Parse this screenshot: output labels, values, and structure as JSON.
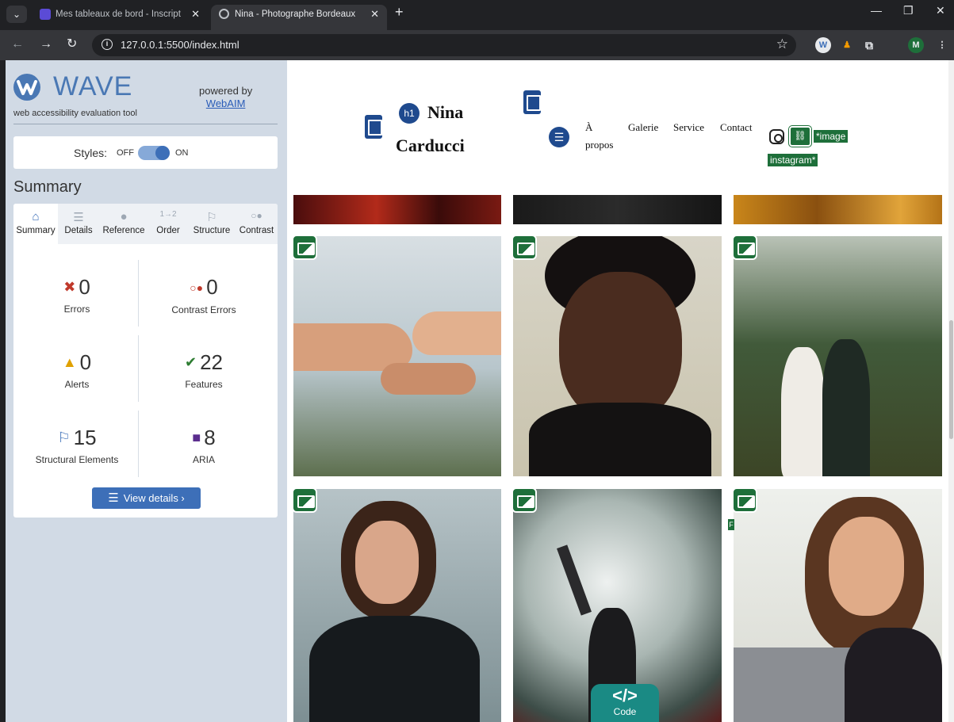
{
  "browser": {
    "tabs": [
      {
        "title": "Mes tableaux de bord - Inscript",
        "active": false
      },
      {
        "title": "Nina - Photographe Bordeaux",
        "active": true
      }
    ],
    "url": "127.0.0.1:5500/index.html",
    "profile_initial": "M"
  },
  "wave": {
    "title": "WAVE",
    "subtitle": "web accessibility evaluation tool",
    "powered_by": "powered by",
    "webaim": "WebAIM",
    "styles_label": "Styles:",
    "styles_off": "OFF",
    "styles_on": "ON",
    "summary_heading": "Summary",
    "tabs": [
      {
        "label": "Summary"
      },
      {
        "label": "Details"
      },
      {
        "label": "Reference"
      },
      {
        "label": "Order"
      },
      {
        "label": "Structure"
      },
      {
        "label": "Contrast"
      }
    ],
    "stats": {
      "errors": {
        "value": "0",
        "label": "Errors"
      },
      "contrast": {
        "value": "0",
        "label": "Contrast Errors"
      },
      "alerts": {
        "value": "0",
        "label": "Alerts"
      },
      "features": {
        "value": "22",
        "label": "Features"
      },
      "structural": {
        "value": "15",
        "label": "Structural Elements"
      },
      "aria": {
        "value": "8",
        "label": "ARIA"
      }
    },
    "view_details": "View details ›",
    "colors": {
      "accent": "#3d6fb8",
      "panel_bg": "#d1dae5",
      "error": "#c0392b",
      "alert": "#e0a100",
      "feature": "#2e7d32"
    }
  },
  "site": {
    "h1_badge": "h1",
    "title_line1": "Nina",
    "title_line2": "Carducci",
    "nav": {
      "apropos_a": "À",
      "apropos_b": "propos",
      "galerie": "Galerie",
      "service": "Service",
      "contact": "Contact"
    },
    "alt_text_line1": "*image",
    "alt_text_line2": "instagram*",
    "code_badge_symbol": "</>",
    "code_badge_label": "Code",
    "f_marker": "F"
  }
}
